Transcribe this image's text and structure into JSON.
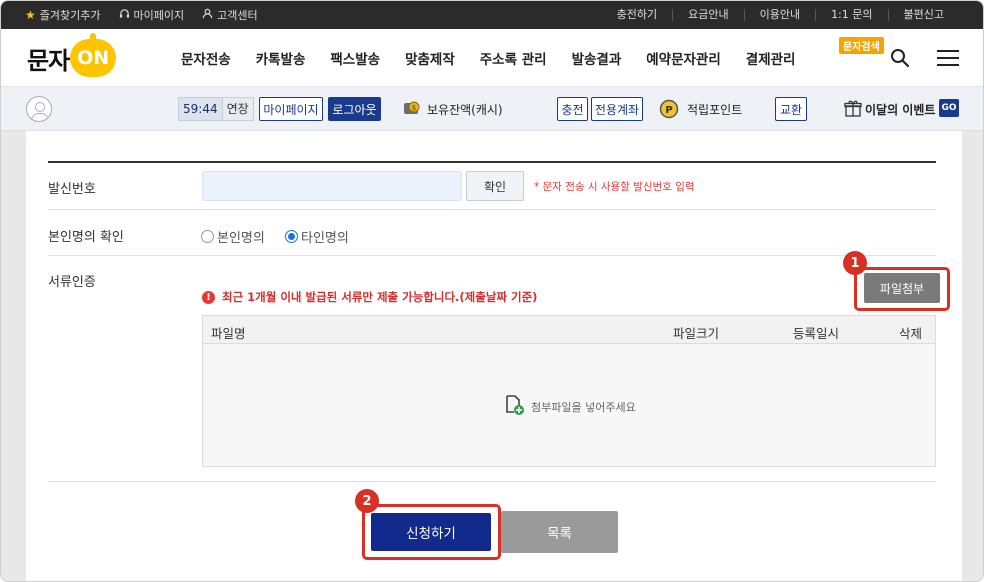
{
  "topbar": {
    "left": [
      "즐겨찾기추가",
      "마이페이지",
      "고객센터"
    ],
    "right": [
      "충전하기",
      "요금안내",
      "이용안내",
      "1:1 문의",
      "불편신고"
    ]
  },
  "header": {
    "logo_text": "문자",
    "logo_on": "ON",
    "nav": [
      "문자전송",
      "카톡발송",
      "팩스발송",
      "맞춤제작",
      "주소록 관리",
      "발송결과",
      "예약문자관리",
      "결제관리"
    ],
    "search_badge": "문자검색"
  },
  "subbar": {
    "timer": "59:44",
    "extend": "연장",
    "mypage": "마이페이지",
    "logout": "로그아웃",
    "balance": "보유잔액(캐시)",
    "charge": "충전",
    "dedicated": "전용계좌",
    "points": "적립포인트",
    "exchange": "교환",
    "event": "이달의 이벤트",
    "go": "GO"
  },
  "form": {
    "sender_label": "발신번호",
    "sender_value": "",
    "confirm": "확인",
    "sender_note": "* 문자 전송 시 사용할 발신번호 입력",
    "identity_label": "본인명의 확인",
    "radio_self": "본인명의",
    "radio_other": "타인명의",
    "doc_label": "서류인증",
    "warning": "최근 1개월 이내 발급된 서류만 제출 가능합니다.(제출날짜 기준)",
    "attach": "파일첨부",
    "table_headers": [
      "파일명",
      "파일크기",
      "등록일시",
      "삭제"
    ],
    "empty": "첨부파일을 넣어주세요",
    "apply": "신청하기",
    "list": "목록"
  },
  "markers": [
    "1",
    "2"
  ],
  "colors": {
    "accent": "#122a8c",
    "highlight": "#d93025",
    "logo": "#ffc400"
  }
}
